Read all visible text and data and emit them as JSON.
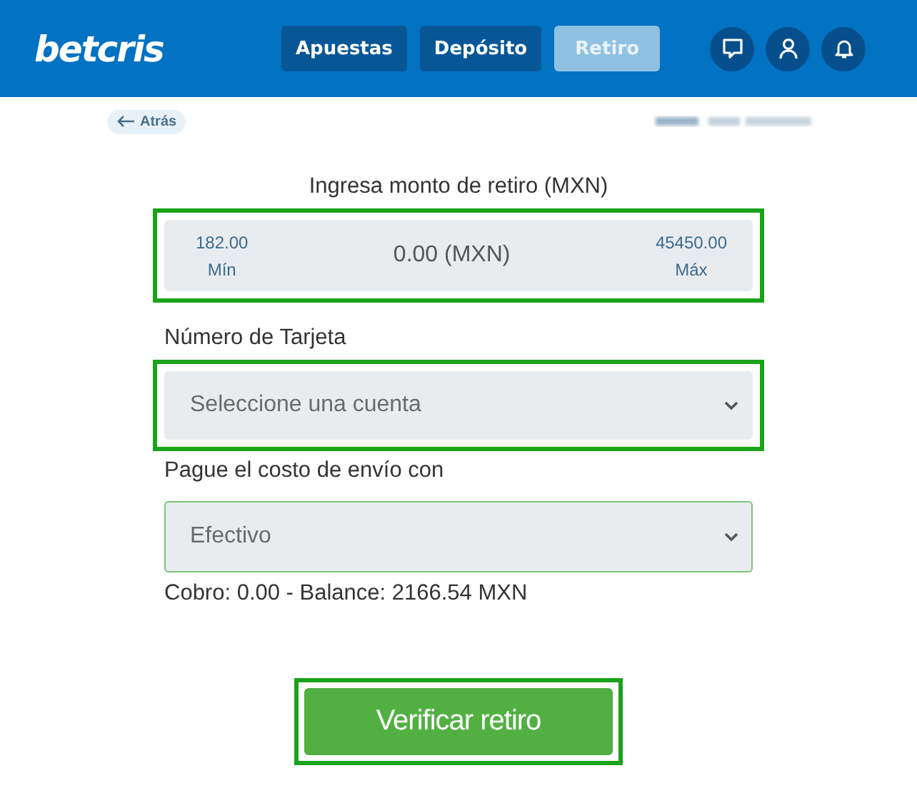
{
  "header": {
    "logo": "betcris",
    "tabs": [
      {
        "label": "Apuestas",
        "selected": false
      },
      {
        "label": "Depósito",
        "selected": false
      },
      {
        "label": "Retiro",
        "selected": true
      }
    ]
  },
  "back_link": "Atrás",
  "amount": {
    "label": "Ingresa monto de retiro (MXN)",
    "min_value": "182.00",
    "min_label": "Mín",
    "value": "0.00 (MXN)",
    "max_value": "45450.00",
    "max_label": "Máx",
    "highlighted": true
  },
  "card_field": {
    "label": "Número de Tarjeta",
    "placeholder": "Seleccione una cuenta",
    "highlighted": true
  },
  "shipping_field": {
    "label": "Pague el costo de envío con",
    "value": "Efectivo"
  },
  "summary": "Cobro: 0.00 - Balance: 2166.54 MXN",
  "submit": {
    "label": "Verificar retiro",
    "highlighted": true
  }
}
